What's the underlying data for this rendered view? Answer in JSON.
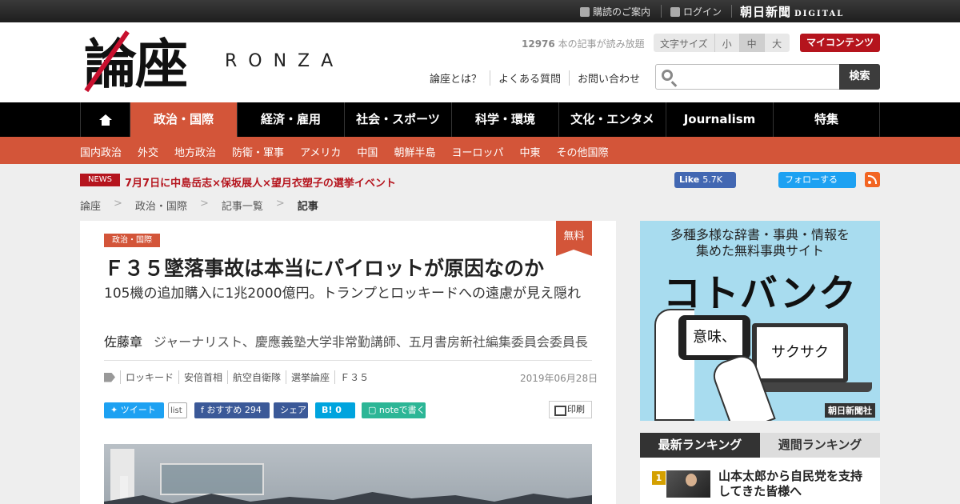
{
  "topbar": {
    "subscribe": "購読のご案内",
    "login": "ログイン",
    "brand": "朝日新聞",
    "brand_sub": "DIGITAL"
  },
  "header": {
    "logo_kanji": "論座",
    "logo_latin": "RONZA",
    "read_count": "12976",
    "read_count_suffix": "本の記事が読み放題",
    "font_size_label": "文字サイズ",
    "font_sizes": [
      "小",
      "中",
      "大"
    ],
    "font_size_selected": "中",
    "my_content": "マイコンテンツ",
    "links": [
      "論座とは？",
      "よくある質問",
      "お問い合わせ"
    ],
    "search_placeholder": "",
    "search_button": "検索"
  },
  "main_nav": {
    "tabs": [
      "政治・国際",
      "経済・雇用",
      "社会・スポーツ",
      "科学・環境",
      "文化・エンタメ",
      "Journalism",
      "特集"
    ],
    "active": "政治・国際"
  },
  "sub_nav": [
    "国内政治",
    "外交",
    "地方政治",
    "防衛・軍事",
    "アメリカ",
    "中国",
    "朝鮮半島",
    "ヨーロッパ",
    "中東",
    "その他国際"
  ],
  "news": {
    "badge": "NEWS",
    "text": "7月7日に中島岳志×保坂展人×望月衣塑子の選挙イベント"
  },
  "social": {
    "fb_like": "Like",
    "fb_count": "5.7K",
    "tw_follow": "フォローする"
  },
  "breadcrumb": [
    "論座",
    "政治・国際",
    "記事一覧",
    "記事"
  ],
  "breadcrumb_sep": ">",
  "article": {
    "category": "政治・国際",
    "free_badge": "無料",
    "title": "Ｆ３５墜落事故は本当にパイロットが原因なのか",
    "subtitle": "105機の追加購入に1兆2000億円。トランプとロッキードへの遠慮が見え隠れ",
    "author_name": "佐藤章",
    "author_desc": "ジャーナリスト、慶應義塾大学非常勤講師、五月書房新社編集委員会委員長",
    "tags": [
      "ロッキード",
      "安倍首相",
      "航空自衛隊",
      "選挙論座",
      "Ｆ３５"
    ],
    "date": "2019年06月28日",
    "share": {
      "tweet": "ツイート",
      "list": "list",
      "fb_recommend": "おすすめ",
      "fb_count": "294",
      "share": "シェア",
      "hatena": "B!",
      "hatena_count": "0",
      "note": "noteで書く",
      "print": "印刷"
    }
  },
  "ad": {
    "line1": "多種多様な辞書・事典・情報を",
    "line2": "集めた無料事典サイト",
    "big": "コトバンク",
    "phone_text": "意味、",
    "laptop_text": "サクサク",
    "source": "朝日新聞社"
  },
  "ranking": {
    "tabs": [
      "最新ランキング",
      "週間ランキング"
    ],
    "active": "最新ランキング",
    "items": [
      {
        "rank": "1",
        "title": "山本太郎から自民党を支持してきた皆様へ"
      }
    ]
  }
}
